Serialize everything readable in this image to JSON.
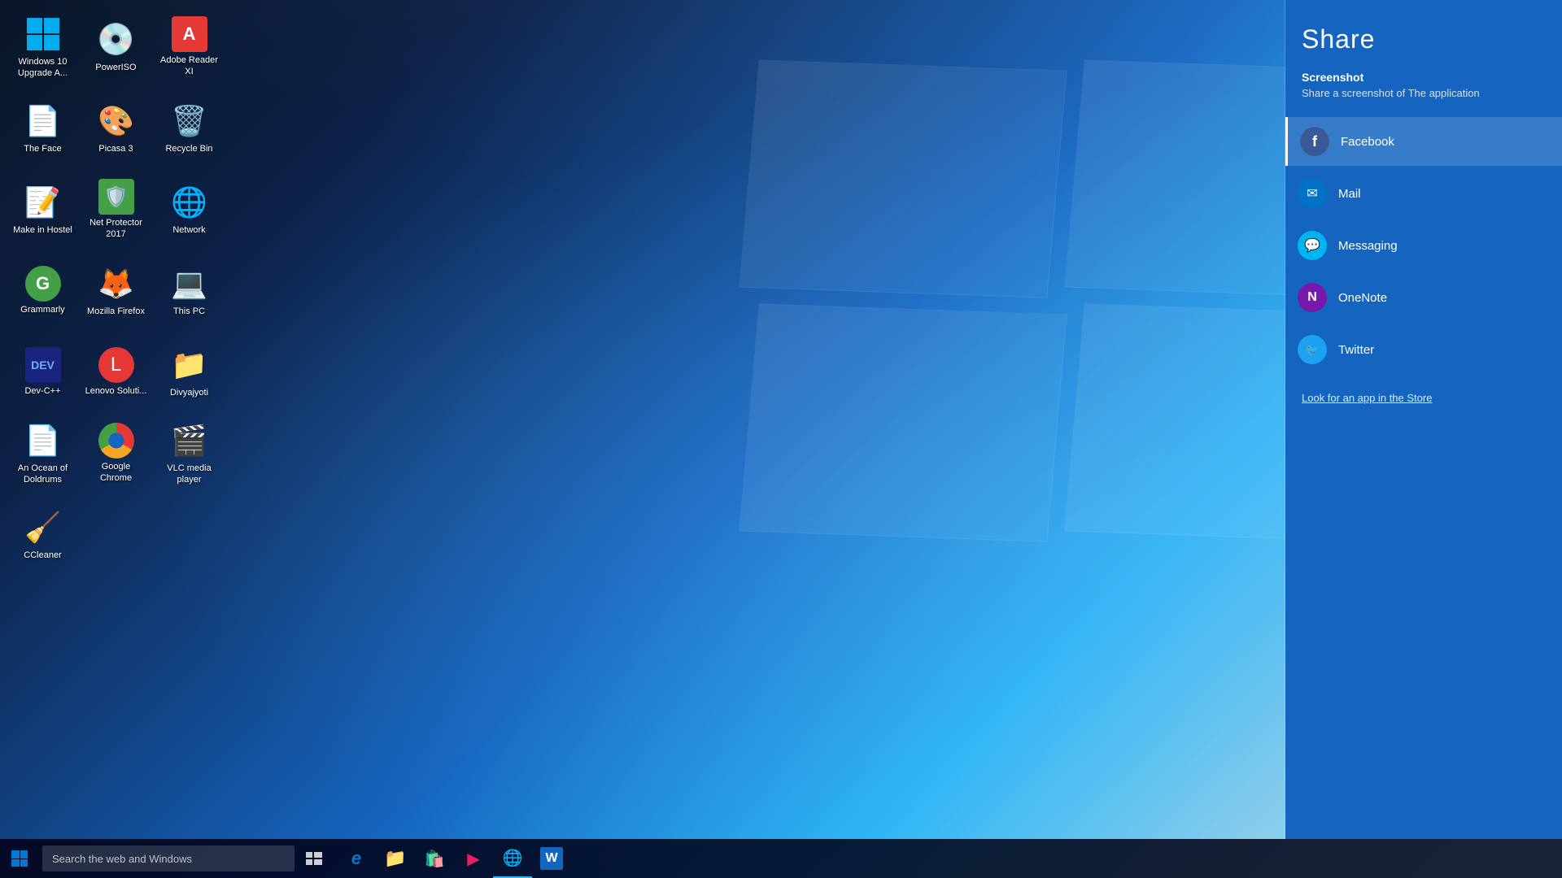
{
  "desktop": {
    "background_note": "Windows 10 blue gradient"
  },
  "icons": [
    {
      "id": "win10-upgrade",
      "label": "Windows 10 Upgrade A...",
      "emoji": "🪟",
      "color": "#0078d7"
    },
    {
      "id": "poweriso",
      "label": "PowerISO",
      "emoji": "💿",
      "color": "#f5a623"
    },
    {
      "id": "adobe-reader",
      "label": "Adobe Reader XI",
      "emoji": "📄",
      "color": "#e53935"
    },
    {
      "id": "the-face",
      "label": "The Face",
      "emoji": "📝",
      "color": "#1565c0"
    },
    {
      "id": "picasa3",
      "label": "Picasa 3",
      "emoji": "🎨",
      "color": "#4db6ac"
    },
    {
      "id": "recycle-bin",
      "label": "Recycle Bin",
      "emoji": "🗑️",
      "color": "#607d8b"
    },
    {
      "id": "make-in-hostel",
      "label": "Make in Hostel",
      "emoji": "📝",
      "color": "#1565c0"
    },
    {
      "id": "net-protector",
      "label": "Net Protector 2017",
      "emoji": "🛡️",
      "color": "#43a047"
    },
    {
      "id": "network",
      "label": "Network",
      "emoji": "🌐",
      "color": "#0078d7"
    },
    {
      "id": "grammarly",
      "label": "Grammarly",
      "emoji": "G",
      "color": "#43a047"
    },
    {
      "id": "mozilla-firefox",
      "label": "Mozilla Firefox",
      "emoji": "🦊",
      "color": "#ef6c00"
    },
    {
      "id": "this-pc",
      "label": "This PC",
      "emoji": "💻",
      "color": "#607d8b"
    },
    {
      "id": "dev-cpp",
      "label": "Dev-C++",
      "emoji": "⚙️",
      "color": "#1565c0"
    },
    {
      "id": "lenovo-solution",
      "label": "Lenovo Soluti...",
      "emoji": "🔴",
      "color": "#e53935"
    },
    {
      "id": "divyajyoti",
      "label": "Divyajyoti",
      "emoji": "📁",
      "color": "#f5a623"
    },
    {
      "id": "ocean-of-doldrums",
      "label": "An Ocean of Doldrums",
      "emoji": "📝",
      "color": "#1565c0"
    },
    {
      "id": "google-chrome",
      "label": "Google Chrome",
      "emoji": "🌐",
      "color": "#4caf50"
    },
    {
      "id": "vlc",
      "label": "VLC media player",
      "emoji": "🎬",
      "color": "#ef6c00"
    },
    {
      "id": "ccleaner",
      "label": "CCleaner",
      "emoji": "🧹",
      "color": "#0078d7"
    }
  ],
  "taskbar": {
    "search_placeholder": "Search the web and Windows",
    "apps": [
      {
        "id": "task-view",
        "emoji": "⬜",
        "label": "Task View"
      },
      {
        "id": "edge",
        "emoji": "e",
        "label": "Microsoft Edge"
      },
      {
        "id": "file-explorer",
        "emoji": "📁",
        "label": "File Explorer"
      },
      {
        "id": "store",
        "emoji": "🛍️",
        "label": "Windows Store"
      },
      {
        "id": "media-player",
        "emoji": "▶️",
        "label": "Media Player"
      },
      {
        "id": "chrome-taskbar",
        "emoji": "🌐",
        "label": "Google Chrome",
        "active": true
      },
      {
        "id": "word-taskbar",
        "emoji": "W",
        "label": "Microsoft Word"
      }
    ]
  },
  "share_panel": {
    "title": "Share",
    "screenshot_label": "Screenshot",
    "description": "Share a screenshot of The application",
    "items": [
      {
        "id": "facebook",
        "label": "Facebook",
        "icon_type": "fb",
        "active": true
      },
      {
        "id": "mail",
        "label": "Mail",
        "icon_type": "mail",
        "active": false
      },
      {
        "id": "messaging",
        "label": "Messaging",
        "icon_type": "msg",
        "active": false
      },
      {
        "id": "onenote",
        "label": "OneNote",
        "icon_type": "onenote",
        "active": false
      },
      {
        "id": "twitter",
        "label": "Twitter",
        "icon_type": "twitter",
        "active": false
      }
    ],
    "store_link": "Look for an app in the Store"
  }
}
